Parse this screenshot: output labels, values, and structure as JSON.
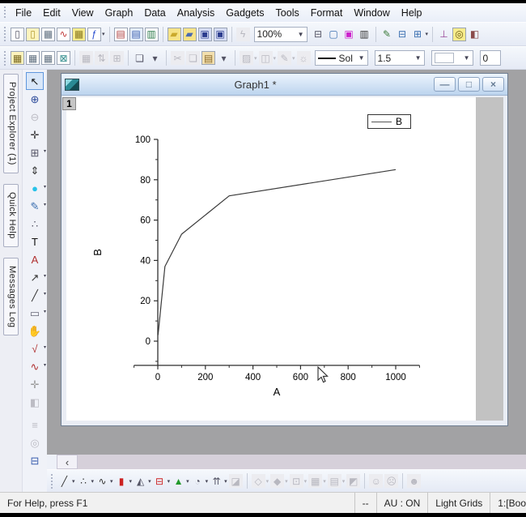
{
  "menu": {
    "items": [
      "File",
      "Edit",
      "View",
      "Graph",
      "Data",
      "Analysis",
      "Gadgets",
      "Tools",
      "Format",
      "Window",
      "Help"
    ]
  },
  "toolbar_top": {
    "zoom_value": "100%",
    "buttons_left": [
      {
        "n": "new-project-icon",
        "g": "▯",
        "bg": "#ffffff",
        "fg": "#556"
      },
      {
        "n": "new-folder-icon",
        "g": "▯",
        "bg": "#fdf3bd",
        "fg": "#b09a30"
      },
      {
        "n": "new-workbook-icon",
        "g": "▦",
        "bg": "#ffffff",
        "fg": "#607080"
      },
      {
        "n": "new-graph-icon",
        "g": "∿",
        "bg": "#ffffff",
        "fg": "#c03a3a"
      },
      {
        "n": "new-matrix-icon",
        "g": "▦",
        "bg": "#f8ec8c",
        "fg": "#8a7a20"
      },
      {
        "n": "new-function-icon",
        "g": "ƒ",
        "bg": "#ffffff",
        "fg": "#2b4fd0",
        "d": true
      },
      {
        "sep": true
      },
      {
        "n": "new-layout-icon",
        "g": "▤",
        "bg": "#ffffff",
        "fg": "#b04040"
      },
      {
        "n": "new-notes-icon",
        "g": "▤",
        "bg": "#e4edfb",
        "fg": "#3a5fae"
      },
      {
        "n": "new-excel-icon",
        "g": "▥",
        "bg": "#ffffff",
        "fg": "#2c7a4a"
      },
      {
        "sep": true
      },
      {
        "n": "open-icon",
        "g": "▰",
        "bg": "#f6e387",
        "fg": "#caa92c"
      },
      {
        "n": "open-template-icon",
        "g": "▰",
        "bg": "#f6e387",
        "fg": "#4a6ab0"
      },
      {
        "n": "save-icon",
        "g": "▣",
        "bg": "#d6ddf4",
        "fg": "#2c3d8f"
      },
      {
        "n": "save-template-icon",
        "g": "▣",
        "bg": "#d6ddf4",
        "fg": "#2c3d8f"
      },
      {
        "sep": true
      },
      {
        "n": "script-runner-icon",
        "g": "ϟ",
        "gr": true
      }
    ],
    "buttons_right": [
      {
        "n": "print-icon",
        "g": "⊟",
        "fg": "#556"
      },
      {
        "n": "slideshow-icon",
        "g": "▢",
        "fg": "#3a6fb0"
      },
      {
        "n": "video-capture-icon",
        "g": "▣",
        "fg": "#cc22cc"
      },
      {
        "n": "film-strip-icon",
        "g": "▥",
        "fg": "#333"
      },
      {
        "sep": true
      },
      {
        "n": "format-edit-icon",
        "g": "✎",
        "fg": "#3a7a3a"
      },
      {
        "n": "split-workspace-icon",
        "g": "⊟",
        "fg": "#3a6fb0"
      },
      {
        "n": "arrange-windows-icon",
        "g": "⊞",
        "fg": "#3a6fb0",
        "d": true
      },
      {
        "sep": true
      },
      {
        "n": "project-explorer-icon",
        "g": "⊥",
        "fg": "#9a4a9a"
      },
      {
        "n": "search-icon",
        "g": "◎",
        "bg": "#f8ec8c",
        "fg": "#6a5a10"
      },
      {
        "n": "screen-capture-icon",
        "g": "◧",
        "fg": "#8a4a4a"
      }
    ]
  },
  "toolbar_format": {
    "line_style_value": "Sol",
    "line_width_value": "1.5",
    "border_width_value": "0",
    "buttons_left": [
      {
        "n": "import-wizard-icon",
        "g": "▦",
        "bg": "#fdf3bd",
        "fg": "#7a6a20"
      },
      {
        "n": "import-ascii-icon",
        "g": "▦",
        "bg": "#ffffff",
        "fg": "#607080"
      },
      {
        "n": "import-multiple-ascii-icon",
        "g": "▦",
        "bg": "#ffffff",
        "fg": "#607080"
      },
      {
        "n": "reimport-icon",
        "g": "⊠",
        "bg": "#ffffff",
        "fg": "#2c8a8a"
      },
      {
        "sep": true
      },
      {
        "n": "new-sheet-icon",
        "g": "▦",
        "gr": true
      },
      {
        "n": "sort-icon",
        "g": "⇅",
        "gr": true
      },
      {
        "n": "pivot-table-icon",
        "g": "⊞",
        "gr": true
      },
      {
        "sep": true
      },
      {
        "n": "duplicate-window-icon",
        "g": "❏",
        "fg": "#556"
      },
      {
        "n": "toolbar-overflow-icon",
        "g": "▾",
        "fg": "#556"
      },
      {
        "sep": true
      },
      {
        "n": "cut-icon",
        "g": "✂",
        "gr": true
      },
      {
        "n": "copy-icon",
        "g": "❏",
        "gr": true
      },
      {
        "n": "paste-icon",
        "g": "▤",
        "bg": "#f2dfae",
        "fg": "#8a6a2a"
      },
      {
        "n": "toolbar-overflow-icon",
        "g": "▾",
        "fg": "#556"
      },
      {
        "sep": true
      },
      {
        "n": "fill-color-icon",
        "g": "▨",
        "gr": true,
        "d": true
      },
      {
        "n": "pattern-icon",
        "g": "◫",
        "gr": true,
        "d": true
      },
      {
        "n": "line-color-icon",
        "g": "✎",
        "gr": true,
        "d": true
      },
      {
        "n": "highlight-icon",
        "g": "☼",
        "gr": true
      }
    ]
  },
  "side_tabs": [
    {
      "label": "Project Explorer (1)"
    },
    {
      "label": "Quick Help"
    },
    {
      "label": "Messages Log"
    }
  ],
  "tools_toolbar": {
    "buttons": [
      {
        "n": "pointer-tool-icon",
        "g": "↖",
        "fg": "#111",
        "sel": true
      },
      {
        "n": "zoom-in-tool-icon",
        "g": "⊕",
        "fg": "#2c4a9a"
      },
      {
        "n": "zoom-out-tool-icon",
        "g": "⊖",
        "gr": true
      },
      {
        "n": "screen-reader-icon",
        "g": "✛",
        "fg": "#333"
      },
      {
        "n": "regional-zoom-icon",
        "g": "⊞",
        "fg": "#556",
        "d": true
      },
      {
        "n": "data-selector-icon",
        "g": "⇕",
        "fg": "#333"
      },
      {
        "n": "mask-tool-icon",
        "g": "●",
        "fg": "#28c2e8",
        "d": true
      },
      {
        "n": "draw-data-icon",
        "g": "✎",
        "fg": "#3a6fb0",
        "d": true
      },
      {
        "n": "cluster-tool-icon",
        "g": "∴",
        "fg": "#556"
      },
      {
        "n": "text-tool-icon",
        "g": "T",
        "fg": "#111"
      },
      {
        "n": "annotation-tool-icon",
        "g": "A",
        "fg": "#b03030"
      },
      {
        "n": "arrow-tool-icon",
        "g": "↗",
        "fg": "#333",
        "d": true
      },
      {
        "n": "line-tool-icon",
        "g": "╱",
        "fg": "#333",
        "d": true
      },
      {
        "n": "rectangle-tool-icon",
        "g": "▭",
        "fg": "#667",
        "d": true
      },
      {
        "n": "pan-tool-icon",
        "g": "✋",
        "fg": "#a8884a"
      },
      {
        "n": "formula-tool-icon",
        "g": "√",
        "fg": "#b03030",
        "d": true
      },
      {
        "n": "insert-graph-icon",
        "g": "∿",
        "fg": "#b03030",
        "d": true
      },
      {
        "n": "pan-axes-icon",
        "g": "✛",
        "fg": "#999"
      },
      {
        "n": "rotate-3d-icon",
        "g": "◧",
        "gr": true
      },
      {
        "sep": true
      },
      {
        "n": "stack-lines-icon",
        "g": "≡",
        "gr": true
      },
      {
        "n": "spiral-icon",
        "g": "◎",
        "gr": true
      },
      {
        "n": "layer-contents-icon",
        "g": "⊟",
        "fg": "#3a5fae"
      }
    ]
  },
  "graph_window": {
    "title": "Graph1 *",
    "page_number": "1",
    "legend": {
      "series_label": "B"
    },
    "controls": {
      "minimize": "—",
      "restore": "□",
      "close": "×"
    },
    "chart_data": {
      "type": "line",
      "title": "",
      "xlabel": "A",
      "ylabel": "B",
      "series": [
        {
          "name": "B",
          "x": [
            1,
            30,
            100,
            300,
            1000
          ],
          "y": [
            3,
            37,
            53,
            72,
            85
          ]
        }
      ],
      "xlim": [
        -100,
        1100
      ],
      "ylim": [
        -12,
        100
      ],
      "x_ticks": [
        0,
        200,
        400,
        600,
        800,
        1000
      ],
      "y_ticks": [
        0,
        20,
        40,
        60,
        80,
        100
      ],
      "x_minor_ticks": [
        -100,
        100,
        300,
        500,
        700,
        900,
        1100
      ],
      "y_minor_ticks": [
        -10,
        10,
        30,
        50,
        70,
        90
      ],
      "grid": false,
      "legend_position": "top-right",
      "line_color": "#3a3a3a"
    }
  },
  "mdi_scrollbar": {
    "left_arrow": "‹"
  },
  "plot_toolbar": {
    "buttons": [
      {
        "n": "line-plot-icon",
        "g": "╱",
        "fg": "#333",
        "d": true
      },
      {
        "n": "scatter-plot-icon",
        "g": "∴",
        "fg": "#333",
        "d": true
      },
      {
        "n": "line-symbol-plot-icon",
        "g": "∿",
        "fg": "#333",
        "d": true
      },
      {
        "n": "column-plot-icon",
        "g": "▮",
        "fg": "#cc2222",
        "d": true
      },
      {
        "n": "area-plot-icon",
        "g": "◭",
        "fg": "#556",
        "d": true
      },
      {
        "n": "box-plot-icon",
        "g": "⊟",
        "fg": "#cc2222",
        "d": true
      },
      {
        "n": "multi-curve-plot-icon",
        "g": "▲",
        "fg": "#22992c",
        "d": true
      },
      {
        "n": "polar-plot-icon",
        "g": "◔",
        "fg": "#556",
        "d": true
      },
      {
        "n": "vector-plot-icon",
        "g": "⇈",
        "fg": "#556",
        "d": true
      },
      {
        "n": "template-3d-icon",
        "g": "◪",
        "gr": true
      },
      {
        "sep": true
      },
      {
        "n": "3d-scatter-icon",
        "g": "◇",
        "gr": true,
        "d": true
      },
      {
        "n": "3d-surface-icon",
        "g": "◆",
        "gr": true,
        "d": true
      },
      {
        "n": "3d-wireframe-icon",
        "g": "⊡",
        "gr": true,
        "d": true
      },
      {
        "n": "contour-plot-icon",
        "g": "▦",
        "gr": true,
        "d": true
      },
      {
        "n": "heatmap-plot-icon",
        "g": "▤",
        "gr": true,
        "d": true
      },
      {
        "n": "image-plot-icon",
        "g": "◩",
        "gr": true
      },
      {
        "sep": true
      },
      {
        "n": "mask-points-icon",
        "g": "☺",
        "gr": true
      },
      {
        "n": "unmask-points-icon",
        "g": "☹",
        "gr": true
      },
      {
        "sep": true
      },
      {
        "n": "mask-color-icon",
        "g": "☻",
        "gr": true
      }
    ]
  },
  "statusbar": {
    "help_text": "For Help, press F1",
    "fields": [
      "--",
      "AU : ON",
      "Light Grids",
      "1:[Boo"
    ]
  },
  "colors": {
    "mdi_background": "#a2a2a4",
    "titlebar_top": "#ecf4fd",
    "titlebar_bottom": "#bcd4ee",
    "page_background": "#ffffff",
    "curve": "#3a3a3a"
  }
}
